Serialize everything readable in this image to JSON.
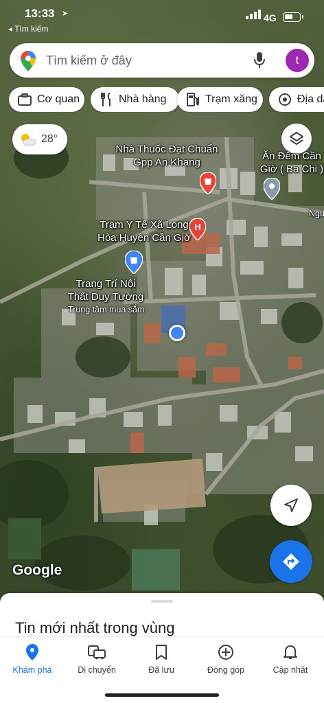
{
  "status_bar": {
    "time": "13:33",
    "back_app": "◂ Tìm kiếm",
    "network": "4G"
  },
  "search": {
    "placeholder": "Tìm kiếm ở đây",
    "avatar_letter": "t"
  },
  "chips": [
    {
      "label": "Cơ quan",
      "icon": "briefcase-icon"
    },
    {
      "label": "Nhà hàng",
      "icon": "restaurant-icon"
    },
    {
      "label": "Trạm xăng",
      "icon": "gas-station-icon"
    },
    {
      "label": "Địa da",
      "icon": "landmark-icon"
    }
  ],
  "weather": {
    "temperature": "28°",
    "icon": "partly-cloudy-icon"
  },
  "map_labels": {
    "pharmacy": "Nhà Thuốc Đạt Chuẩn\nGpp An Khang",
    "restaurant": "Ăn Đêm Cần\nGiờ ( Ba Chi )",
    "health_station": "Trạm Y Tế Xã Long\nHòa Huyện Cần Giờ",
    "interior_store": "Trang Trí Nội\nThất Duy Tường",
    "interior_store_sub": "Trung tâm mua sắm",
    "edge_label": "Ngu"
  },
  "google_logo": "Google",
  "bottom_sheet": {
    "title": "Tin mới nhất trong vùng"
  },
  "nav": [
    {
      "label": "Khám phá",
      "icon": "explore-pin-icon",
      "active": true
    },
    {
      "label": "Di chuyển",
      "icon": "commute-icon",
      "active": false
    },
    {
      "label": "Đã lưu",
      "icon": "bookmark-icon",
      "active": false
    },
    {
      "label": "Đóng góp",
      "icon": "add-circle-icon",
      "active": false
    },
    {
      "label": "Cập nhật",
      "icon": "bell-icon",
      "active": false
    }
  ],
  "colors": {
    "accent_blue": "#1a73e8",
    "avatar_purple": "#9c27b0",
    "poi_red": "#ea4335"
  }
}
